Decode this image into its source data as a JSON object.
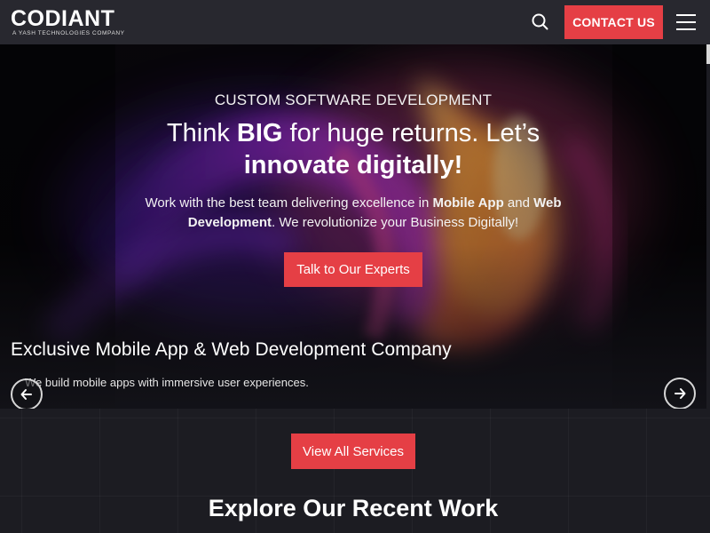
{
  "header": {
    "logo_text": "CODIANT",
    "logo_tagline": "A YASH TECHNOLOGIES COMPANY",
    "contact_label": "CONTACT US"
  },
  "hero": {
    "eyebrow": "CUSTOM SOFTWARE DEVELOPMENT",
    "headline_part1": "Think ",
    "headline_bold1": "BIG",
    "headline_part2": " for huge returns. Let’s",
    "headline_bold2": "innovate digitally!",
    "sub_part1": "Work with the best team delivering excellence in ",
    "sub_bold1": "Mobile App",
    "sub_part2": " and ",
    "sub_bold2": "Web Development",
    "sub_part3": ". We revolutionize your Business Digitally!",
    "cta_label": "Talk to Our Experts"
  },
  "slider": {
    "title": "Exclusive Mobile App & Web Development Company",
    "description": "We build mobile apps with immersive user experiences."
  },
  "services": {
    "button_label": "View All Services"
  },
  "recent_work": {
    "title": "Explore Our Recent Work"
  },
  "colors": {
    "accent": "#e53f45",
    "header_bg": "#28282f",
    "page_bg": "#1c1c22"
  },
  "icons": {
    "search": "search-icon",
    "menu": "hamburger-menu-icon",
    "prev": "arrow-left-icon",
    "next": "arrow-right-icon"
  }
}
